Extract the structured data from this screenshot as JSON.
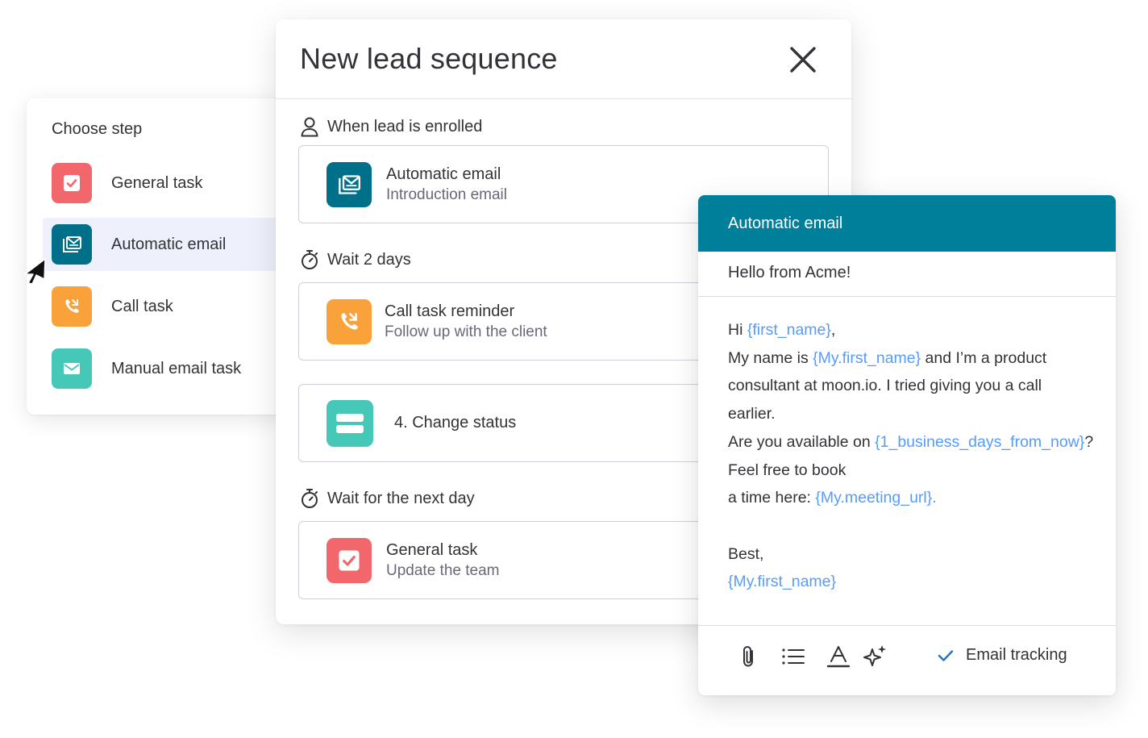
{
  "choose_step": {
    "title": "Choose step",
    "items": [
      {
        "label": "General task",
        "icon": "checkbox-icon",
        "color": "#f2676b"
      },
      {
        "label": "Automatic email",
        "icon": "email-stack-icon",
        "color": "#00708a",
        "active": true
      },
      {
        "label": "Call task",
        "icon": "phone-icon",
        "color": "#f9a23b"
      },
      {
        "label": "Manual email task",
        "icon": "envelope-icon",
        "color": "#46c8b8"
      }
    ]
  },
  "modal": {
    "title": "New lead sequence",
    "sections": [
      {
        "label": "When lead is enrolled",
        "icon": "person-icon"
      },
      {
        "label": "Wait 2 days",
        "icon": "stopwatch-icon"
      },
      {
        "label": "Wait for the next day",
        "icon": "stopwatch-icon"
      }
    ],
    "steps": [
      {
        "title": "Automatic email",
        "subtitle": "Introduction email",
        "icon": "email-stack-icon",
        "color": "#00708a"
      },
      {
        "title": "Call task reminder",
        "subtitle": "Follow up with the client",
        "icon": "phone-icon",
        "color": "#f9a23b"
      },
      {
        "title": "4. Change status",
        "subtitle": "",
        "icon": "status-icon",
        "color": "#46c8b8"
      },
      {
        "title": "General task",
        "subtitle": "Update the team",
        "icon": "checkbox-icon",
        "color": "#f2676b"
      }
    ]
  },
  "email": {
    "header": "Automatic email",
    "subject": "Hello from Acme!",
    "body": {
      "greeting": "Hi ",
      "var_first_name": "{first_name}",
      "comma": ",",
      "l2_a": "My name is ",
      "var_my_first_name": "{My.first_name}",
      "l2_b": " and I’m a product",
      "l3": "consultant at moon.io. I tried giving you a call",
      "l4": "earlier.",
      "l5_a": "Are you available on ",
      "var_business_days": "{1_business_days_from_now}",
      "l5_b": "?",
      "l6": "Feel free to book",
      "l7_a": "a time here: ",
      "var_meeting_url": "{My.meeting_url}.",
      "l8": "Best,",
      "signature": "{My.first_name}"
    },
    "toolbar": {
      "tracking_label": "Email tracking",
      "tracking_checked": true,
      "icons": [
        "paperclip-icon",
        "list-icon",
        "text-format-icon",
        "sparkle-icon"
      ]
    }
  },
  "colors": {
    "accent": "#007f9a",
    "link_var": "#579bfc",
    "active_bg": "#eef1fb"
  }
}
